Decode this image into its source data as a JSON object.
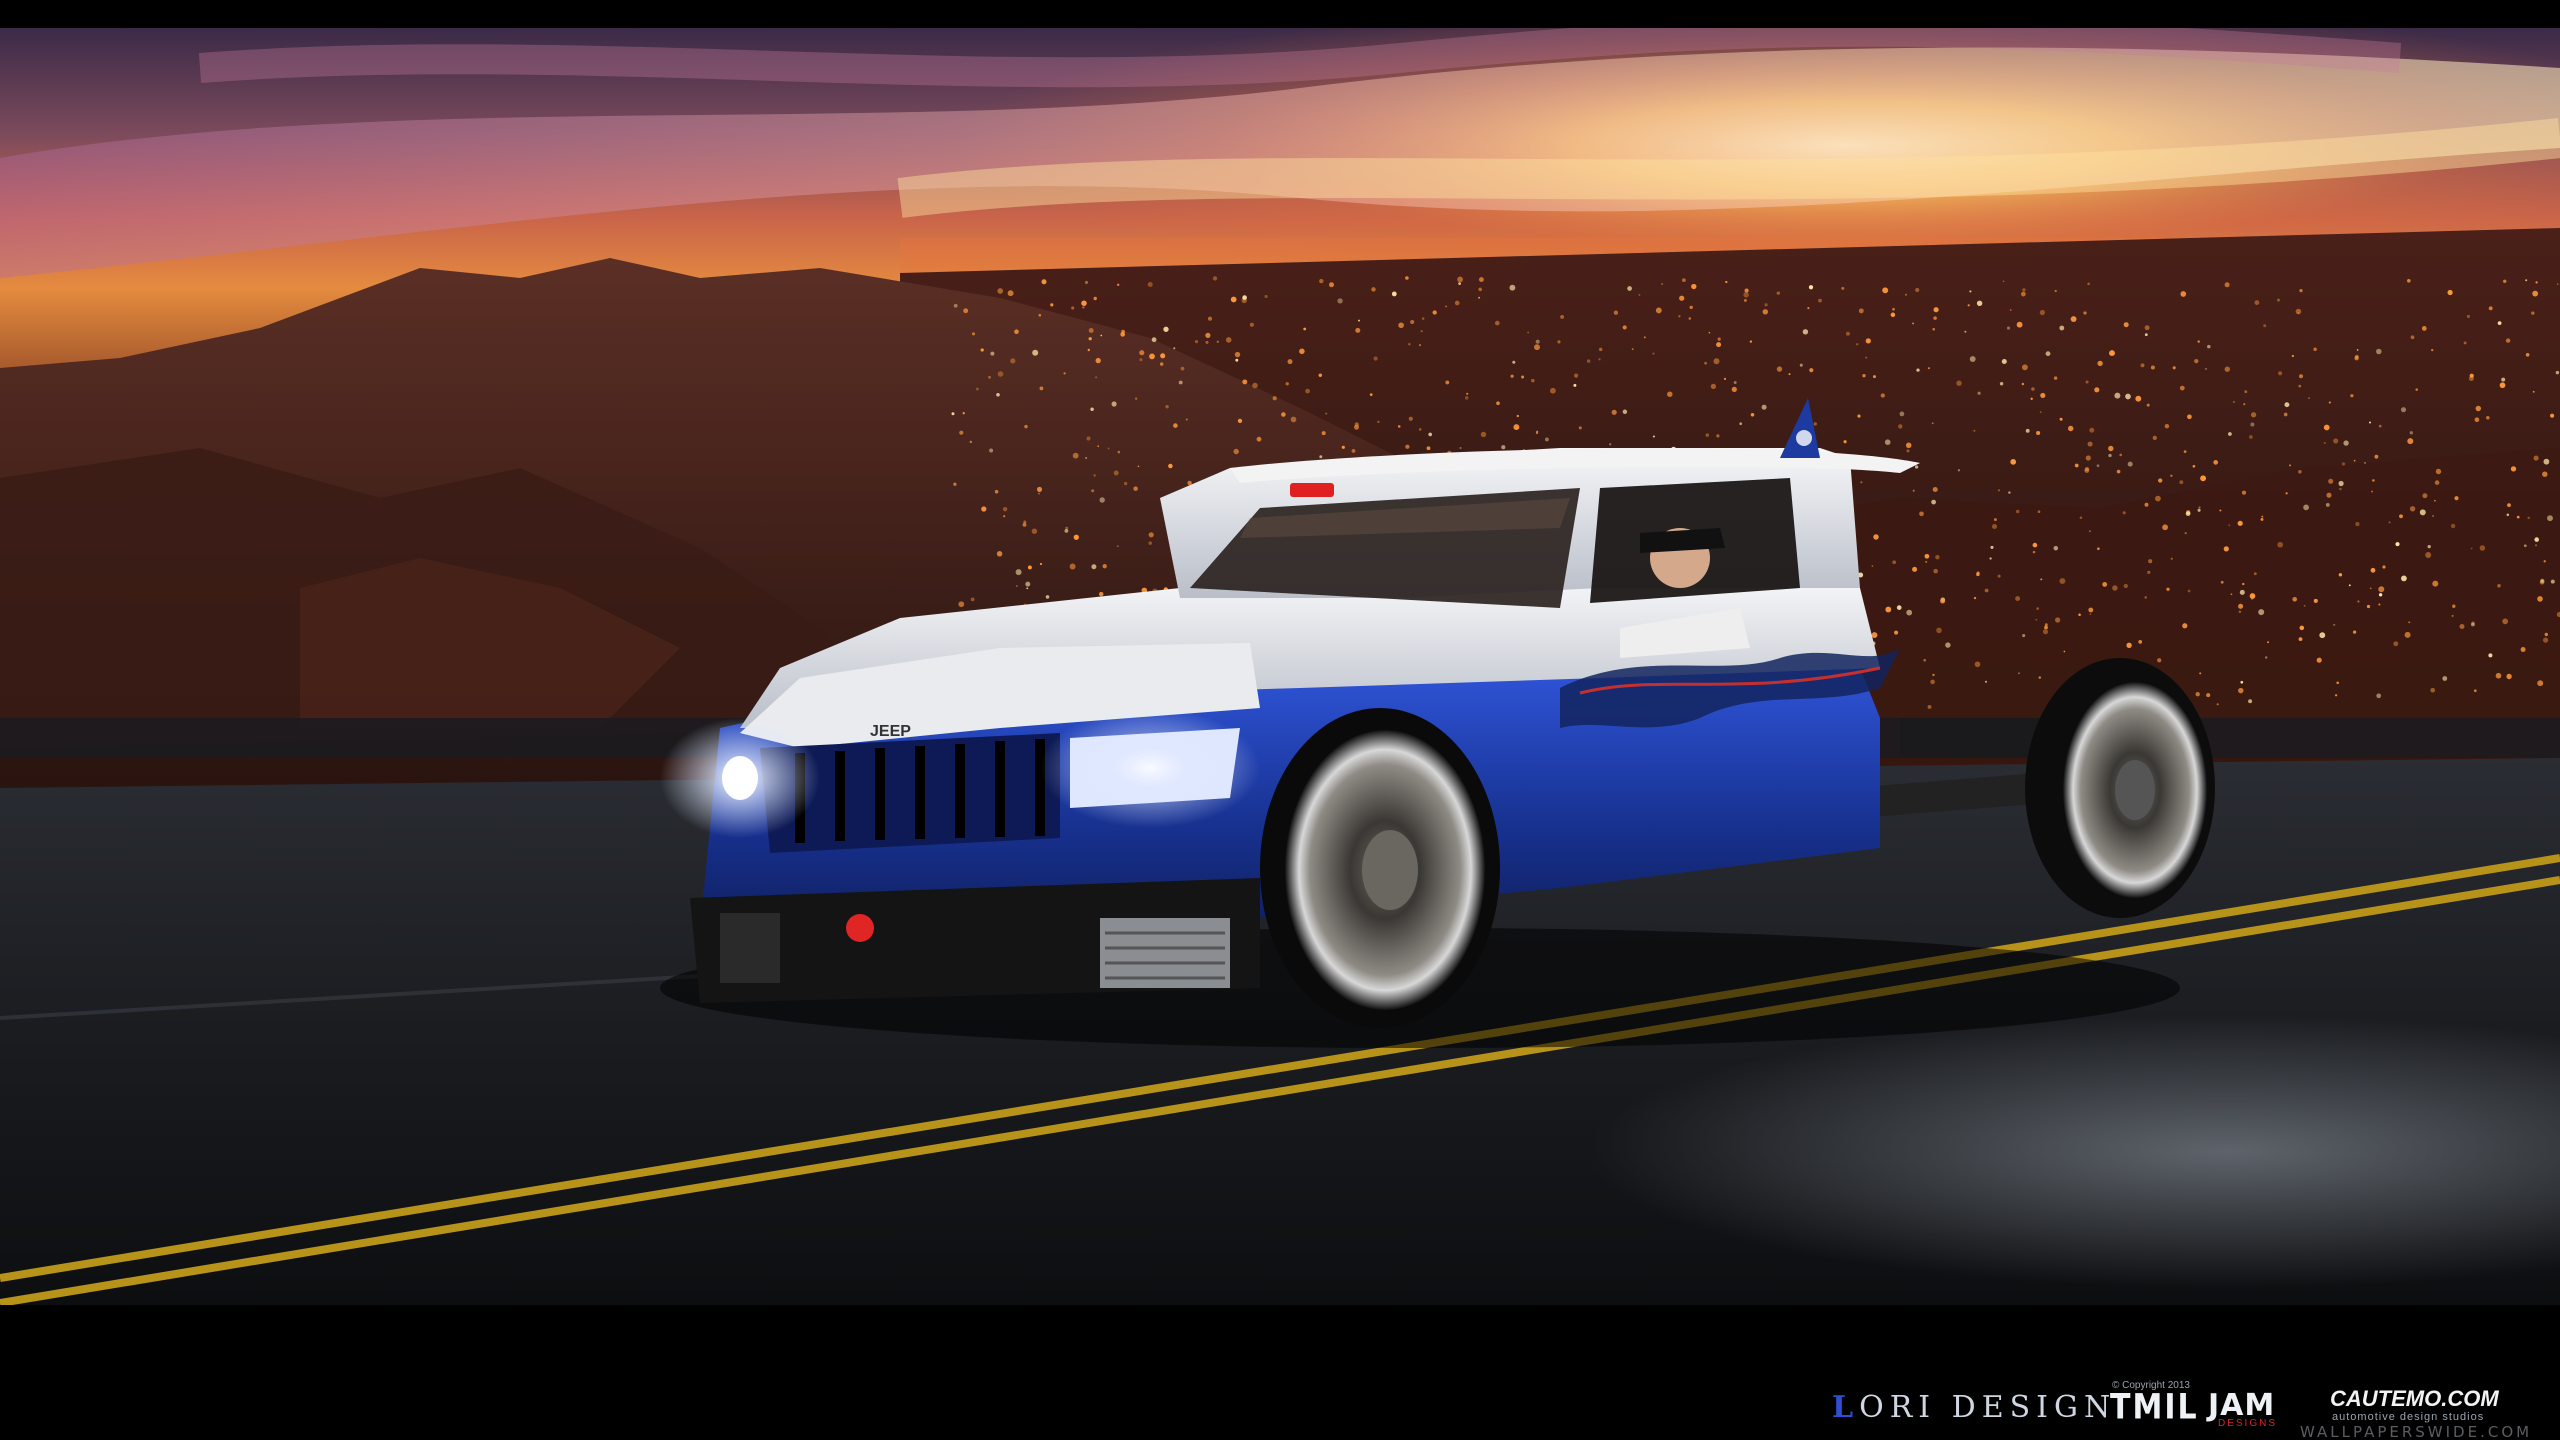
{
  "credits": {
    "lori_lead": "L",
    "lori_text": "ORI DESIGN",
    "copyright": "© Copyright 2013",
    "tmil": "TMIL",
    "jam": "JAM",
    "jam_sub": "DESIGNS",
    "autemo": "CAUTEMO.COM",
    "autemo_tag": "automotive design studios",
    "watermark": "WALLPAPERSWIDE.COM"
  },
  "vehicle": {
    "grille_badge": "JEEP"
  },
  "colors": {
    "sky_top": "#5c3a5a",
    "sunset_glow": "#ffb347",
    "city_lights": "#ff9a3c",
    "road": "#17191d",
    "road_line": "#c9a21a",
    "car_white": "#e8eaee",
    "car_blue": "#1c3aa0",
    "headlight": "#ffffff"
  },
  "icons": {
    "surfboard_fin_logo": "fin-logo-icon",
    "roof_badge": "roof-badge-icon"
  }
}
